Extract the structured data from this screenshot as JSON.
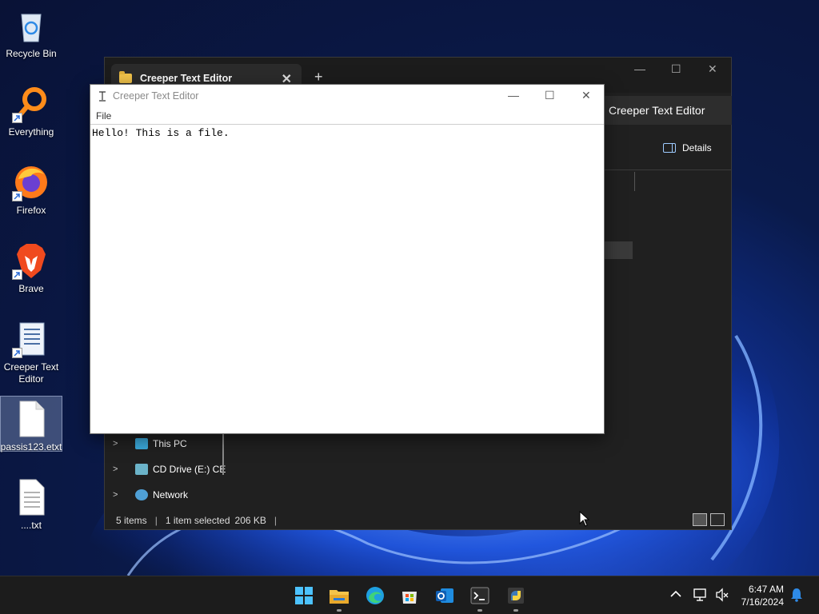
{
  "desktop": {
    "icons": [
      {
        "label": "Recycle Bin",
        "icon": "recycle-bin-icon"
      },
      {
        "label": "Everything",
        "icon": "everything-search-icon"
      },
      {
        "label": "Firefox",
        "icon": "firefox-icon"
      },
      {
        "label": "Brave",
        "icon": "brave-icon"
      },
      {
        "label": "Creeper Text Editor",
        "icon": "text-editor-icon"
      },
      {
        "label": "passis123.etxt",
        "icon": "file-icon"
      },
      {
        "label": "....txt",
        "icon": "text-file-icon"
      }
    ]
  },
  "explorer": {
    "tab_title": "Creeper Text Editor",
    "tab_close": "✕",
    "new_tab": "+",
    "controls": {
      "minimize": "—",
      "maximize": "☐",
      "close": "✕"
    },
    "address": "Creeper Text Editor",
    "details_label": "Details",
    "nav_items": [
      {
        "label": "This PC",
        "icon": "computer-icon"
      },
      {
        "label": "CD Drive (E:) CE",
        "icon": "cd-drive-icon"
      },
      {
        "label": "Network",
        "icon": "network-icon"
      }
    ],
    "status": {
      "items": "5 items",
      "selected": "1 item selected",
      "size": "206 KB"
    }
  },
  "editor": {
    "title": "Creeper Text Editor",
    "menu": [
      "File"
    ],
    "content": "Hello! This is a file.",
    "controls": {
      "minimize": "—",
      "maximize": "☐",
      "close": "✕"
    }
  },
  "taskbar": {
    "apps": [
      "windows-start-icon",
      "file-explorer-icon",
      "edge-icon",
      "microsoft-store-icon",
      "outlook-icon",
      "terminal-icon",
      "python-icon"
    ],
    "clock": {
      "time": "6:47 AM",
      "date": "7/16/2024"
    },
    "tray": {
      "chevron": "^"
    }
  },
  "colors": {
    "taskbar_bg": "#1c1c1c",
    "explorer_bg": "#202020",
    "accent_blue": "#0078d4"
  }
}
